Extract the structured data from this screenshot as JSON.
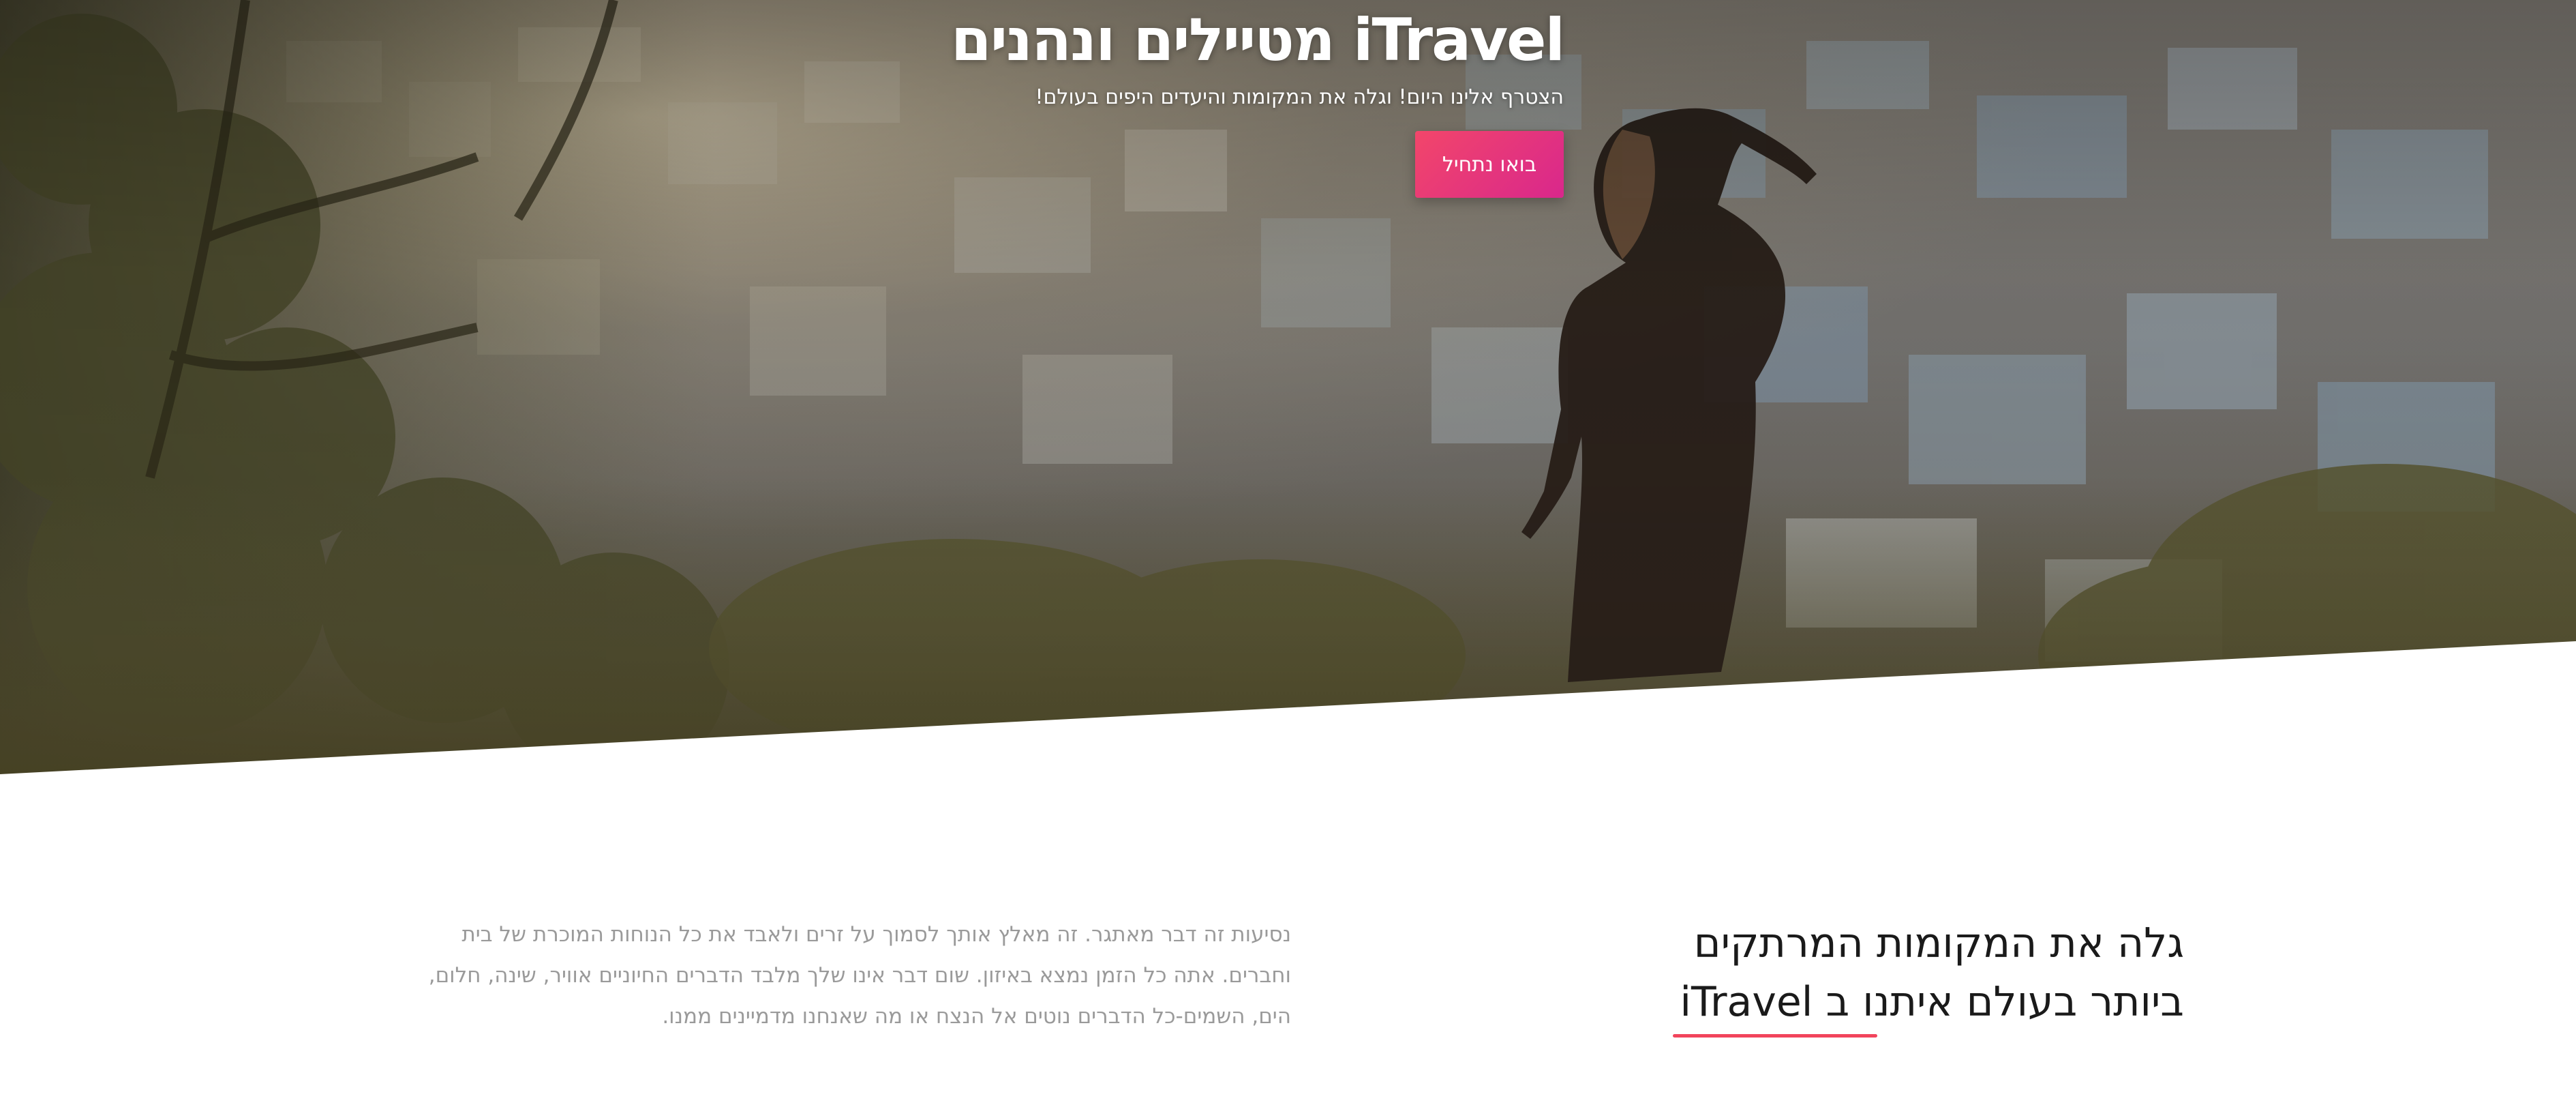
{
  "hero": {
    "title": "iTravel מטיילים ונהנים",
    "subtitle": "הצטרף אלינו היום! וגלה את המקומות והיעדים היפים בעולם!",
    "cta_label": "בואו נתחיל",
    "background_icon": "travel-photo-image"
  },
  "intro": {
    "heading_line1": "גלה את המקומות המרתקים",
    "heading_line2": "ביותר בעולם איתנו ב iTravel",
    "paragraph": "נסיעות זה דבר מאתגר. זה מאלץ אותך לסמוך על זרים ולאבד את כל הנוחות המוכרת של בית וחברים. אתה כל הזמן נמצא באיזון. שום דבר אינו שלך מלבד הדברים החיוניים אוויר, שינה, חלום, הים, השמים-כל הדברים נוטים אל הנצח או מה שאנחנו מדמיינים ממנו."
  },
  "colors": {
    "accent_start": "#f2466a",
    "accent_end": "#d9278c",
    "underline": "#f2445c",
    "paragraph_text": "#9a9a9a",
    "heading_text": "#1a1a1a"
  }
}
